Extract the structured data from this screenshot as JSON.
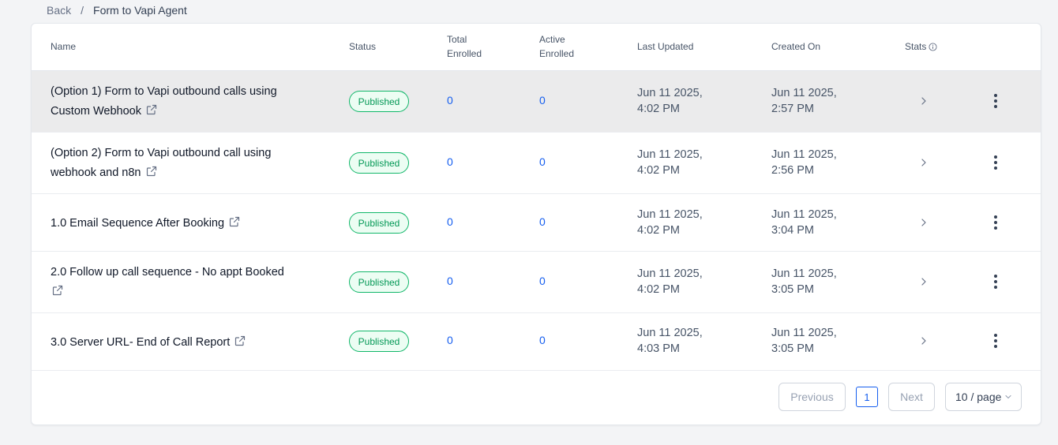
{
  "breadcrumb": {
    "back": "Back",
    "separator": "/",
    "current": "Form to Vapi Agent"
  },
  "table": {
    "headers": {
      "name": "Name",
      "status": "Status",
      "total_enrolled_1": "Total",
      "total_enrolled_2": "Enrolled",
      "active_enrolled_1": "Active",
      "active_enrolled_2": "Enrolled",
      "last_updated": "Last Updated",
      "created_on": "Created On",
      "stats": "Stats"
    },
    "rows": [
      {
        "name_line1": "(Option 1) Form to Vapi outbound calls using",
        "name_line2": "Custom Webhook",
        "status": "Published",
        "total": "0",
        "active": "0",
        "updated_1": "Jun 11 2025,",
        "updated_2": "4:02 PM",
        "created_1": "Jun 11 2025,",
        "created_2": "2:57 PM"
      },
      {
        "name_line1": "(Option 2) Form to Vapi outbound call using",
        "name_line2": "webhook and n8n",
        "status": "Published",
        "total": "0",
        "active": "0",
        "updated_1": "Jun 11 2025,",
        "updated_2": "4:02 PM",
        "created_1": "Jun 11 2025,",
        "created_2": "2:56 PM"
      },
      {
        "name_line1": "1.0 Email Sequence After Booking",
        "name_line2": "",
        "status": "Published",
        "total": "0",
        "active": "0",
        "updated_1": "Jun 11 2025,",
        "updated_2": "4:02 PM",
        "created_1": "Jun 11 2025,",
        "created_2": "3:04 PM"
      },
      {
        "name_line1": "2.0 Follow up call sequence - No appt Booked",
        "name_line2": "",
        "status": "Published",
        "total": "0",
        "active": "0",
        "updated_1": "Jun 11 2025,",
        "updated_2": "4:02 PM",
        "created_1": "Jun 11 2025,",
        "created_2": "3:05 PM"
      },
      {
        "name_line1": "3.0 Server URL- End of Call Report",
        "name_line2": "",
        "status": "Published",
        "total": "0",
        "active": "0",
        "updated_1": "Jun 11 2025,",
        "updated_2": "4:03 PM",
        "created_1": "Jun 11 2025,",
        "created_2": "3:05 PM"
      }
    ]
  },
  "pagination": {
    "previous": "Previous",
    "current_page": "1",
    "next": "Next",
    "page_size": "10 / page"
  },
  "colors": {
    "accent": "#155eef",
    "published": "#12b76a"
  },
  "icons": {
    "external": "external-link-icon",
    "chevron": "chevron-right-icon",
    "kebab": "kebab-menu-icon",
    "info": "info-icon"
  }
}
